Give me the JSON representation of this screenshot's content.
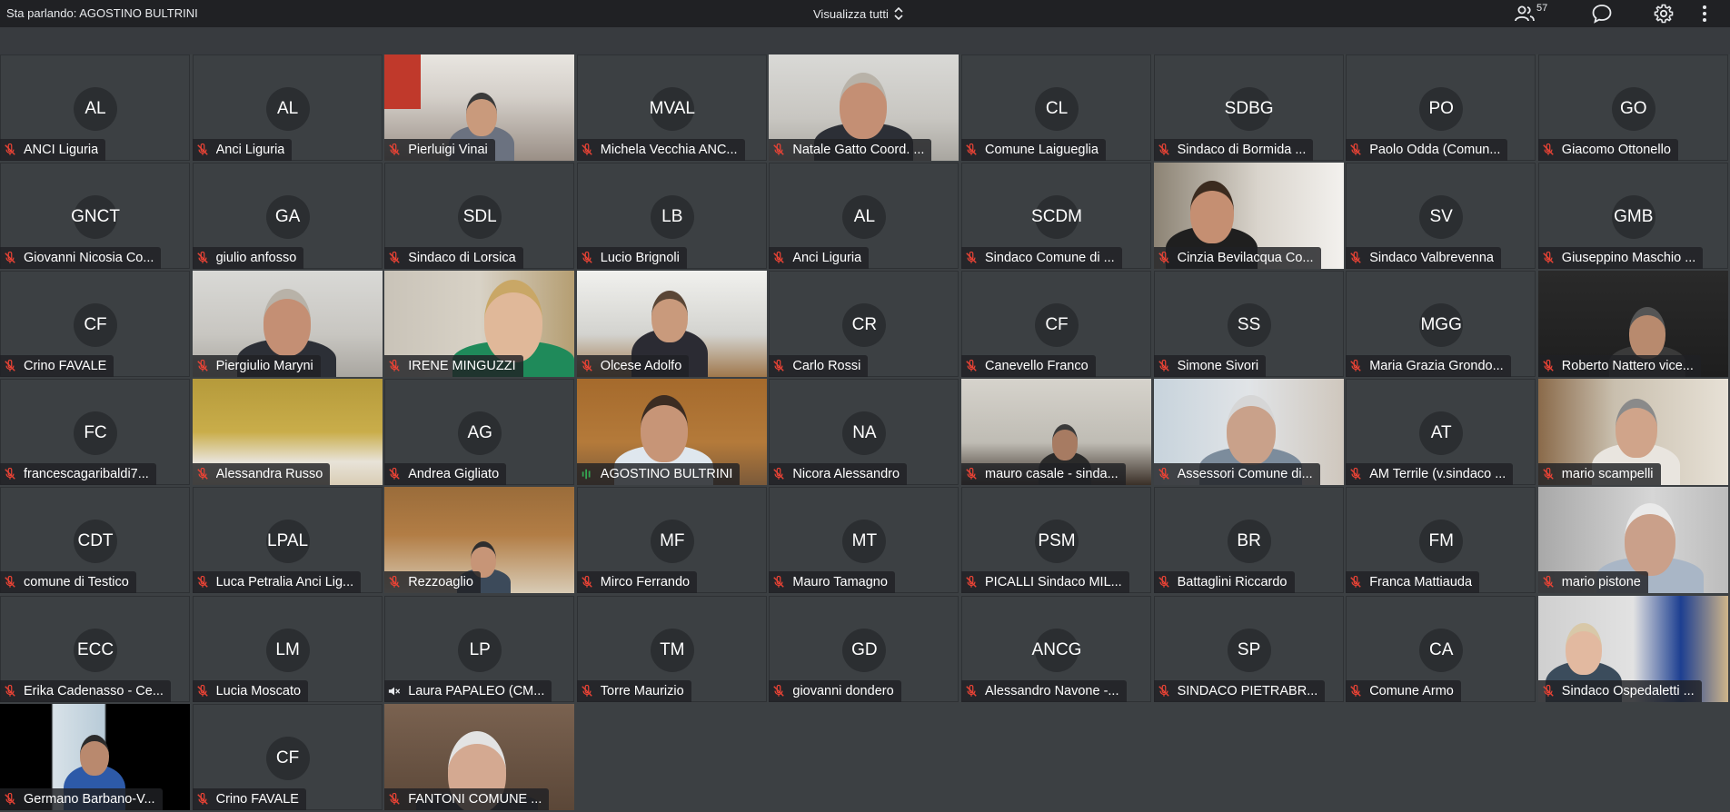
{
  "topbar": {
    "speaking": "Sta parlando: AGOSTINO BULTRINI",
    "view_label": "Visualizza tutti",
    "participants_count": "57",
    "icons": [
      "people-icon",
      "chat-icon",
      "gear-icon",
      "more-vert-icon"
    ]
  },
  "colors": {
    "muted_mic": "#ea4335",
    "speaking_mic": "#34a853",
    "tile_bg": "#3c4043"
  },
  "tiles": [
    {
      "initials": "AL",
      "name": "ANCI Liguria",
      "mic": "muted"
    },
    {
      "initials": "AL",
      "name": "Anci Liguria",
      "mic": "muted"
    },
    {
      "initials": "",
      "name": "Pierluigi Vinai",
      "mic": "muted",
      "video": "office"
    },
    {
      "initials": "MVAL",
      "name": "Michela Vecchia ANC...",
      "mic": "muted"
    },
    {
      "initials": "",
      "name": "Natale Gatto Coord. ...",
      "mic": "muted",
      "video": "headset"
    },
    {
      "initials": "CL",
      "name": "Comune Laigueglia",
      "mic": "muted"
    },
    {
      "initials": "SDBG",
      "name": "Sindaco di Bormida ...",
      "mic": "muted"
    },
    {
      "initials": "PO",
      "name": "Paolo Odda (Comun...",
      "mic": "muted"
    },
    {
      "initials": "GO",
      "name": "Giacomo Ottonello",
      "mic": "muted"
    },
    {
      "initials": "GNCT",
      "name": "Giovanni Nicosia Co...",
      "mic": "muted"
    },
    {
      "initials": "GA",
      "name": "giulio anfosso",
      "mic": "muted"
    },
    {
      "initials": "SDL",
      "name": "Sindaco di Lorsica",
      "mic": "muted"
    },
    {
      "initials": "LB",
      "name": "Lucio Brignoli",
      "mic": "muted"
    },
    {
      "initials": "AL",
      "name": "Anci Liguria",
      "mic": "muted"
    },
    {
      "initials": "SCDM",
      "name": "Sindaco Comune di ...",
      "mic": "muted"
    },
    {
      "initials": "",
      "name": "Cinzia Bevilacqua Co...",
      "mic": "muted",
      "video": "curly"
    },
    {
      "initials": "SV",
      "name": "Sindaco Valbrevenna",
      "mic": "muted"
    },
    {
      "initials": "GMB",
      "name": "Giuseppino Maschio ...",
      "mic": "muted"
    },
    {
      "initials": "CF",
      "name": "Crino FAVALE",
      "mic": "muted"
    },
    {
      "initials": "",
      "name": "Piergiulio Maryni",
      "mic": "muted",
      "video": "headset"
    },
    {
      "initials": "",
      "name": "IRENE MINGUZZI",
      "mic": "muted",
      "video": "blonde"
    },
    {
      "initials": "",
      "name": "Olcese Adolfo",
      "mic": "muted",
      "video": "suit"
    },
    {
      "initials": "CR",
      "name": "Carlo Rossi",
      "mic": "muted"
    },
    {
      "initials": "CF",
      "name": "Canevello Franco",
      "mic": "muted"
    },
    {
      "initials": "SS",
      "name": "Simone Sivori",
      "mic": "muted"
    },
    {
      "initials": "MGG",
      "name": "Maria Grazia Grondo...",
      "mic": "muted"
    },
    {
      "initials": "",
      "name": "Roberto Nattero vice...",
      "mic": "muted",
      "video": "dark"
    },
    {
      "initials": "FC",
      "name": "francescagaribaldi7...",
      "mic": "muted"
    },
    {
      "initials": "",
      "name": "Alessandra Russo",
      "mic": "muted",
      "video": "room"
    },
    {
      "initials": "AG",
      "name": "Andrea Gigliato",
      "mic": "muted"
    },
    {
      "initials": "",
      "name": "AGOSTINO BULTRINI",
      "mic": "speaking",
      "video": "speaker",
      "active": true
    },
    {
      "initials": "NA",
      "name": "Nicora Alessandro",
      "mic": "muted"
    },
    {
      "initials": "",
      "name": "mauro casale - sinda...",
      "mic": "muted",
      "video": "flags"
    },
    {
      "initials": "",
      "name": "Assessori Comune di...",
      "mic": "muted",
      "video": "glasses"
    },
    {
      "initials": "AT",
      "name": "AM Terrile (v.sindaco ...",
      "mic": "muted"
    },
    {
      "initials": "",
      "name": "mario scampelli",
      "mic": "muted",
      "video": "hand"
    },
    {
      "initials": "CDT",
      "name": "comune di Testico",
      "mic": "muted"
    },
    {
      "initials": "LPAL",
      "name": "Luca Petralia Anci Lig...",
      "mic": "muted"
    },
    {
      "initials": "",
      "name": "Rezzoaglio",
      "mic": "muted",
      "video": "wood"
    },
    {
      "initials": "MF",
      "name": "Mirco Ferrando",
      "mic": "muted"
    },
    {
      "initials": "MT",
      "name": "Mauro Tamagno",
      "mic": "muted"
    },
    {
      "initials": "PSM",
      "name": "PICALLI Sindaco MIL...",
      "mic": "muted"
    },
    {
      "initials": "BR",
      "name": "Battaglini Riccardo",
      "mic": "muted"
    },
    {
      "initials": "FM",
      "name": "Franca Mattiauda",
      "mic": "muted"
    },
    {
      "initials": "",
      "name": "mario pistone",
      "mic": "muted",
      "video": "grey"
    },
    {
      "initials": "ECC",
      "name": "Erika Cadenasso - Ce...",
      "mic": "muted"
    },
    {
      "initials": "LM",
      "name": "Lucia Moscato",
      "mic": "muted"
    },
    {
      "initials": "LP",
      "name": "Laura PAPALEO (CM...",
      "mic": "speaker-off"
    },
    {
      "initials": "TM",
      "name": "Torre Maurizio",
      "mic": "muted"
    },
    {
      "initials": "GD",
      "name": "giovanni dondero",
      "mic": "muted"
    },
    {
      "initials": "ANCG",
      "name": "Alessandro Navone -...",
      "mic": "muted"
    },
    {
      "initials": "SP",
      "name": "SINDACO PIETRABR...",
      "mic": "muted"
    },
    {
      "initials": "CA",
      "name": "Comune Armo",
      "mic": "muted"
    },
    {
      "initials": "",
      "name": "Sindaco Ospedaletti ...",
      "mic": "muted",
      "video": "eu"
    },
    {
      "initials": "",
      "name": "Germano Barbano-V...",
      "mic": "muted",
      "video": "blue"
    },
    {
      "initials": "CF",
      "name": "Crino FAVALE",
      "mic": "muted"
    },
    {
      "initials": "",
      "name": "FANTONI COMUNE ...",
      "mic": "muted",
      "video": "fantoni"
    }
  ]
}
